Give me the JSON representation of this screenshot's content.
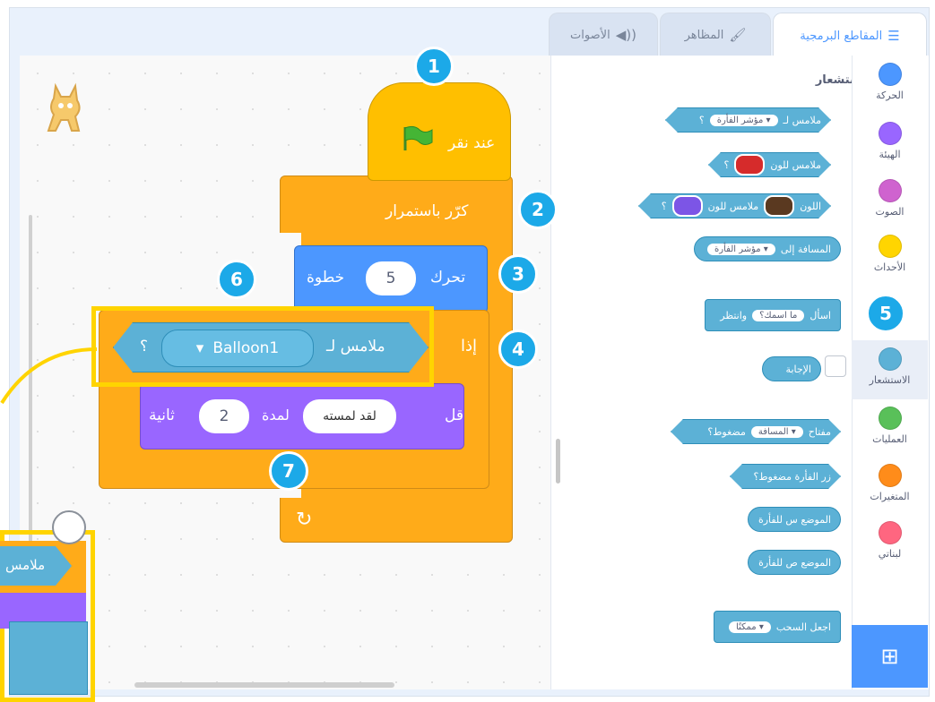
{
  "tabs": [
    {
      "label": "المقاطع البرمجية",
      "icon": "code-icon",
      "active": true
    },
    {
      "label": "المظاهر",
      "icon": "paintbrush-icon",
      "active": false
    },
    {
      "label": "الأصوات",
      "icon": "speaker-icon",
      "active": false
    }
  ],
  "categories": [
    {
      "label": "الحركة",
      "color": "#4c97ff"
    },
    {
      "label": "الهيئة",
      "color": "#9966ff"
    },
    {
      "label": "الصوت",
      "color": "#cf63cf"
    },
    {
      "label": "الأحداث",
      "color": "#ffd500"
    },
    {
      "label": "الاستشعار",
      "color": "#5cb1d6",
      "selected": true
    },
    {
      "label": "العمليات",
      "color": "#59c059"
    },
    {
      "label": "المتغيرات",
      "color": "#ff8c1a"
    },
    {
      "label": "لبناتي",
      "color": "#ff6680"
    }
  ],
  "palette": {
    "heading": "الاستشعار",
    "blocks": {
      "touching_mouse": {
        "text": "ملامس لـ",
        "arg": "مؤشر الفأرة ▾",
        "tail": "؟"
      },
      "touching_color": {
        "text": "ملامس للون",
        "tail": "؟"
      },
      "color_touching_color": {
        "text1": "اللون",
        "text2": "ملامس للون",
        "tail": "؟"
      },
      "distance_to": {
        "text": "المسافة إلى",
        "arg": "مؤشر الفأرة ▾"
      },
      "ask_wait": {
        "text1": "اسأل",
        "arg": "ما اسمك؟",
        "text2": "وانتظر"
      },
      "answer": {
        "text": "الإجابة"
      },
      "key_pressed": {
        "text1": "مفتاح",
        "arg": "المسافة ▾",
        "text2": "مضغوط؟"
      },
      "mouse_down": {
        "text": "زر الفأرة مضغوط؟"
      },
      "mouse_x": {
        "text": "الموضع س للفأرة"
      },
      "mouse_y": {
        "text": "الموضع ص للفأرة"
      },
      "drag_mode": {
        "text": "اجعل السحب",
        "arg": "ممكنًا ▾"
      }
    }
  },
  "script": {
    "when_flag": "عند نقر",
    "forever": "كرّر باستمرار",
    "move": {
      "label": "تحرك",
      "steps": "5",
      "unit": "خطوة"
    },
    "if_label": "إذا",
    "touching": {
      "label": "ملامس لـ",
      "target": "Balloon1",
      "tail": "؟"
    },
    "say": {
      "label": "قل",
      "message": "لقد لمسته",
      "for": "لمدة",
      "secs": "2",
      "unit": "ثانية"
    }
  },
  "overlay": {
    "touching_label": "ملامس"
  },
  "badges": [
    "1",
    "2",
    "3",
    "4",
    "5",
    "6",
    "7"
  ]
}
